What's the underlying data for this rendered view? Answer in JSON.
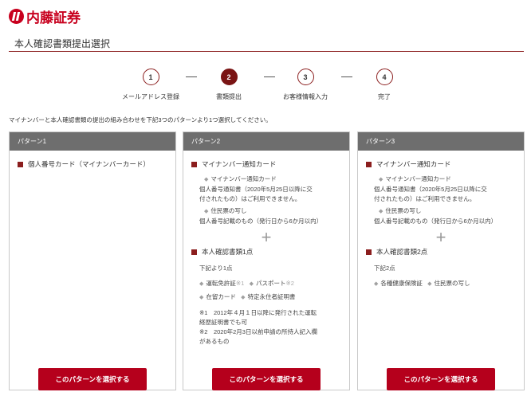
{
  "header": {
    "logo_text": "内藤証券",
    "page_title": "本人確認書類提出選択"
  },
  "steps": [
    {
      "number": "1",
      "label": "メールアドレス登録",
      "active": false
    },
    {
      "number": "2",
      "label": "書類提出",
      "active": true
    },
    {
      "number": "3",
      "label": "お客様情報入力",
      "active": false
    },
    {
      "number": "4",
      "label": "完了",
      "active": false
    }
  ],
  "intro": "マイナンバーと本人確認書類の提出の組み合わせを下記3つのパターンより1つ選択してください。",
  "plus_sign": "+",
  "patterns": [
    {
      "heading": "パターン1",
      "section1_title": "個人番号カード（マイナンバーカード）",
      "button": "このパターンを選択する"
    },
    {
      "heading": "パターン2",
      "section1_title": "マイナンバー通知カード",
      "notice_heading": "マイナンバー通知カード",
      "notice_line1": "個人番号通知書（2020年5月25日以降に交",
      "notice_line2": "付されたもの）はご利用できません。",
      "resident_heading": "住民票の写し",
      "resident_detail": "個人番号記載のもの（発行日から6か月以内）",
      "section2_title": "本人確認書類1点",
      "choose": "下記より1点",
      "item_license": "運転免許証",
      "mark1": "※1",
      "item_passport": "パスポート",
      "mark2": "※2",
      "item_residence": "在留カード",
      "item_permanent": "特定永住者証明書",
      "note1_line1": "※1　2012年４月１日以降に発行された運転",
      "note1_line2": "経歴証明書でも可",
      "note2_line1": "※2　2020年2月3日以前申請の所持人記入欄",
      "note2_line2": "があるもの",
      "button": "このパターンを選択する"
    },
    {
      "heading": "パターン3",
      "section1_title": "マイナンバー通知カード",
      "notice_heading": "マイナンバー通知カード",
      "notice_line1": "個人番号通知書（2020年5月25日以降に交",
      "notice_line2": "付されたもの）はご利用できません。",
      "resident_heading": "住民票の写し",
      "resident_detail": "個人番号記載のもの（発行日から6か月以内）",
      "section2_title": "本人確認書類2点",
      "choose": "下記2点",
      "item_insurance": "各種健康保険証",
      "item_resident": "住民票の写し",
      "button": "このパターンを選択する"
    }
  ]
}
